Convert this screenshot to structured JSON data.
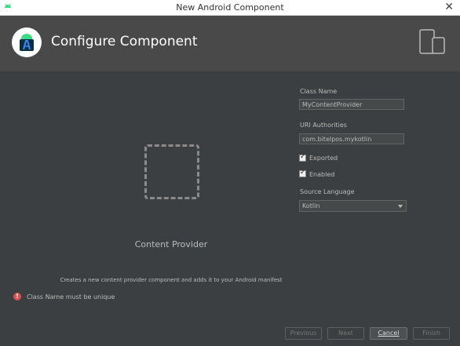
{
  "window": {
    "title": "New Android Component",
    "close_glyph": "✕"
  },
  "header": {
    "title": "Configure Component"
  },
  "preview": {
    "label": "Content Provider",
    "description": "Creates a new content provider component and adds it to your Android manifest"
  },
  "error": {
    "icon": "!",
    "message": "Class Name must be unique"
  },
  "form": {
    "class_name": {
      "label": "Class Name",
      "value": "MyContentProvider"
    },
    "uri_authorities": {
      "label": "URI Authorities",
      "value": "com.bitelpos.mykotlin"
    },
    "exported": {
      "label": "Exported",
      "checked": true
    },
    "enabled": {
      "label": "Enabled",
      "checked": true
    },
    "source_language": {
      "label": "Source Language",
      "value": "Kotlin"
    }
  },
  "buttons": {
    "previous": "Previous",
    "next": "Next",
    "cancel": "Cancel",
    "finish": "Finish"
  },
  "colors": {
    "error": "#d9534f",
    "accent": "#3ddc84",
    "studio_blue": "#3f7ec5"
  },
  "icons": [
    "android-studio-icon",
    "device-icon",
    "error-icon",
    "dropdown-arrow-icon"
  ]
}
